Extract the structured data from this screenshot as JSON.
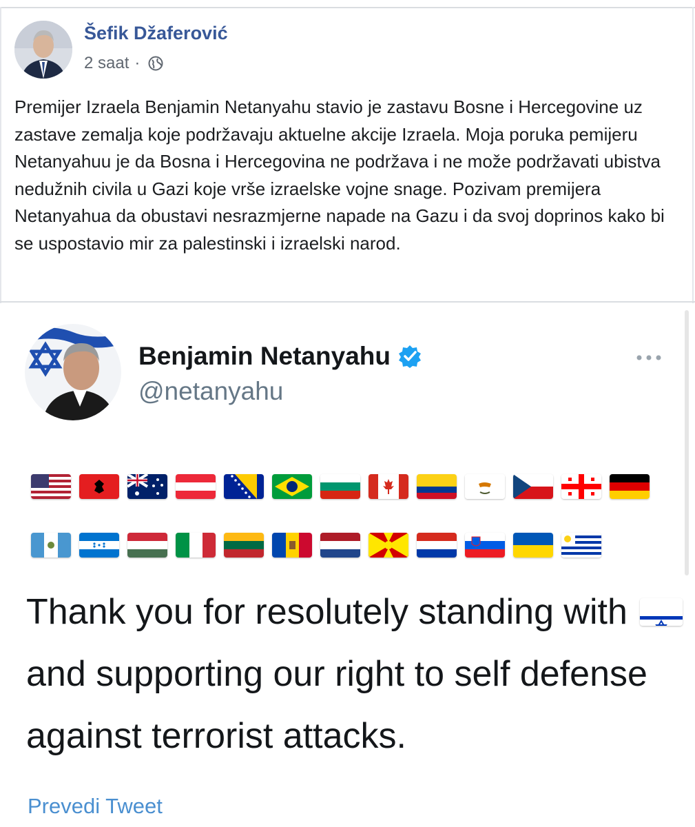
{
  "post": {
    "author": "Šefik Džaferović",
    "time": "2 saat",
    "separator": "·",
    "privacy_icon": "globe-icon",
    "text": "Premijer Izraela Benjamin Netanyahu stavio je zastavu Bosne i Hercegovine uz zastave zemalja koje podržavaju aktuelne akcije Izraela. Moja poruka pemijeru Netanyahuu je da Bosna i Hercegovina ne podržava i ne može podržavati ubistva nedužnih civila u Gazi koje vrše izraelske vojne snage. Pozivam premijera Netanyahua da obustavi nesrazmjerne napade na Gazu i da svoj doprinos kako bi se uspostavio mir za palestinski i izraelski narod."
  },
  "tweet": {
    "name": "Benjamin Netanyahu",
    "handle": "@netanyahu",
    "verified_icon": "verified-badge-icon",
    "more_icon": "more-dots-icon",
    "flags_row1": [
      "us",
      "albania",
      "australia",
      "austria",
      "bosnia-herzegovina",
      "brazil",
      "bulgaria",
      "canada",
      "colombia",
      "cyprus",
      "czechia",
      "georgia",
      "germany"
    ],
    "flags_row2": [
      "guatemala",
      "honduras",
      "hungary",
      "italy",
      "lithuania",
      "moldova",
      "netherlands",
      "north-macedonia",
      "paraguay",
      "slovenia",
      "ukraine",
      "uruguay"
    ],
    "text_part1": "Thank you for resolutely standing with",
    "inline_flag": "israel",
    "text_part2": "and supporting our right to self defense against terrorist attacks.",
    "translate_label": "Prevedi Tweet"
  },
  "colors": {
    "facebook_link": "#385898",
    "tweet_link": "#4a8fd0",
    "verified": "#1da1f2",
    "meta_gray": "#606770"
  }
}
